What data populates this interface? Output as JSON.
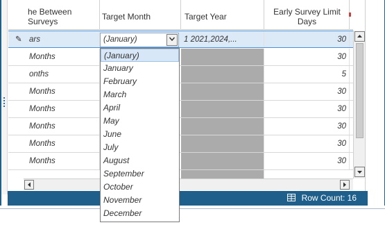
{
  "columns": {
    "between": [
      "he Between",
      "Surveys"
    ],
    "target_month": "Target Month",
    "target_year": "Target Year",
    "early_limit": [
      "Early Survey Limit",
      "Days"
    ]
  },
  "rows": [
    {
      "between": "ars",
      "days": "30",
      "selected": true
    },
    {
      "between": "Months",
      "days": "30"
    },
    {
      "between": "onths",
      "days": "5"
    },
    {
      "between": "Months",
      "days": "30"
    },
    {
      "between": "Months",
      "days": "30"
    },
    {
      "between": "Months",
      "days": "30"
    },
    {
      "between": "Months",
      "days": "30"
    },
    {
      "between": "Months",
      "days": "30"
    }
  ],
  "selected_row": {
    "month_value": "(January)",
    "year_value": "1   2021,2024,..."
  },
  "dropdown": {
    "items": [
      "(January)",
      "January",
      "February",
      "March",
      "April",
      "May",
      "June",
      "July",
      "August",
      "September",
      "October",
      "November",
      "December"
    ],
    "highlighted_index": 0
  },
  "footer": {
    "row_count_label": "Row Count:",
    "row_count": "16"
  },
  "icons": {
    "edit_indicator": "pencil-icon",
    "dropdown_arrow": "chevron-down-icon",
    "table_icon": "grid-icon"
  },
  "colors": {
    "accent": "#1f5f8b",
    "selection": "#dce9f7",
    "disabled_block": "#ababab"
  }
}
